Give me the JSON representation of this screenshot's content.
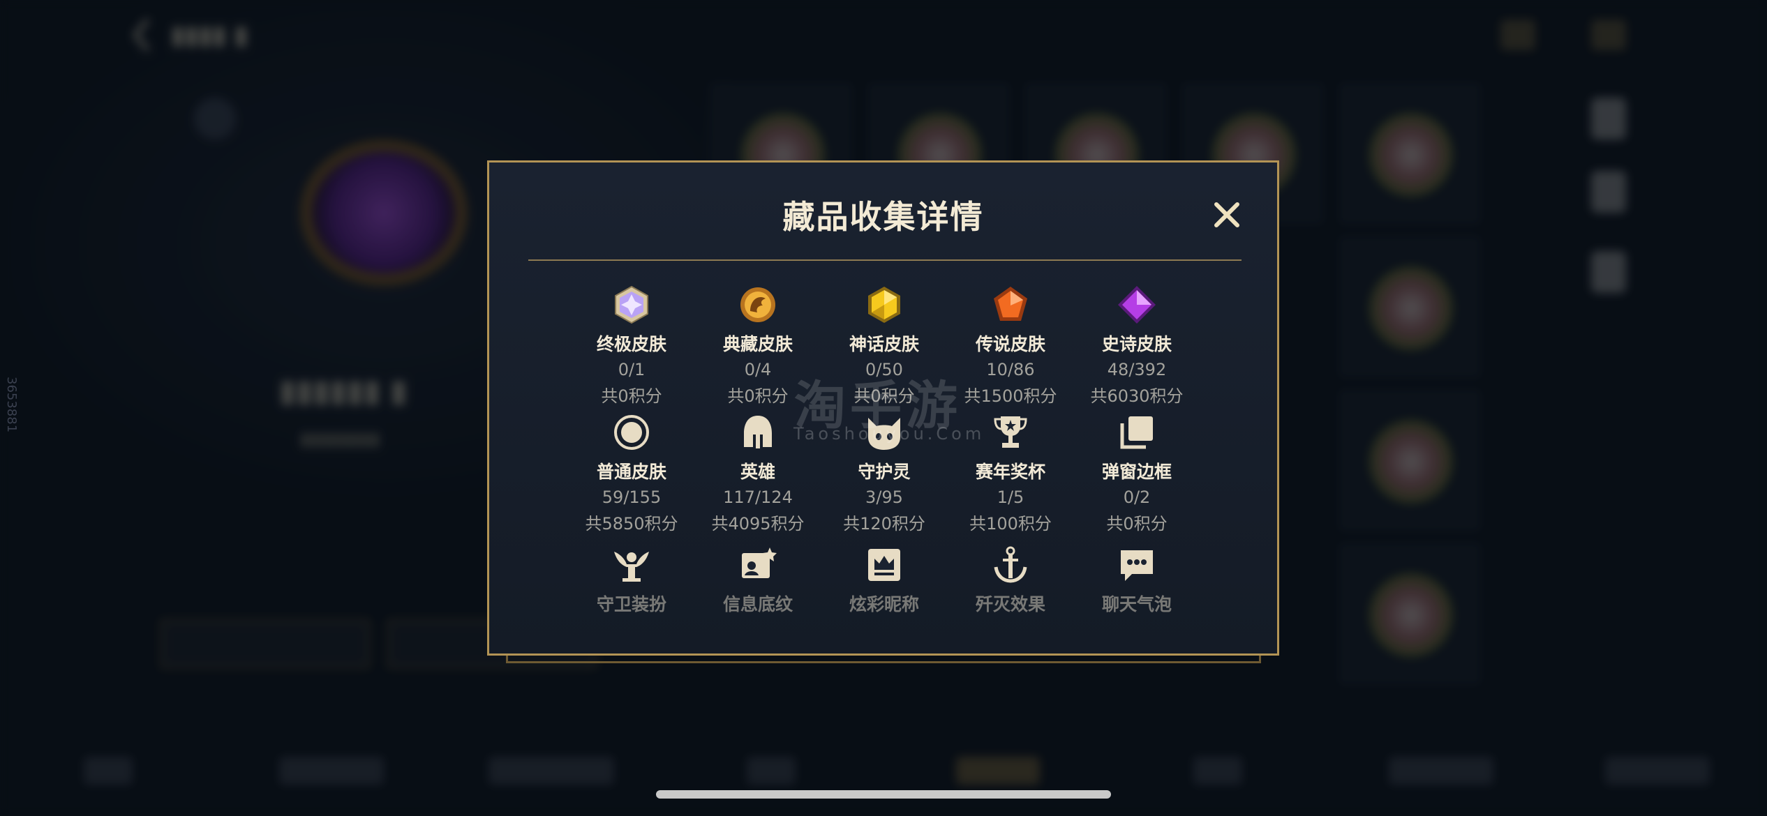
{
  "colors": {
    "gold_border": "#b39455",
    "modal_bg": "#161d28",
    "title_text": "#f3ead5",
    "muted_text": "#a3a29c"
  },
  "dialog": {
    "title": "藏品收集详情",
    "close_icon": "close-icon",
    "items": [
      {
        "name": "终极皮肤",
        "count": "0/1",
        "points": "共0积分",
        "icon": "ultimate-skin-icon",
        "color": "#c9a8ff"
      },
      {
        "name": "典藏皮肤",
        "count": "0/4",
        "points": "共0积分",
        "icon": "collector-skin-icon",
        "color": "#e3a43a"
      },
      {
        "name": "神话皮肤",
        "count": "0/50",
        "points": "共0积分",
        "icon": "mythic-skin-icon",
        "color": "#f2c21b"
      },
      {
        "name": "传说皮肤",
        "count": "10/86",
        "points": "共1500积分",
        "icon": "legendary-skin-icon",
        "color": "#f06a1f"
      },
      {
        "name": "史诗皮肤",
        "count": "48/392",
        "points": "共6030积分",
        "icon": "epic-skin-icon",
        "color": "#b23be0"
      },
      {
        "name": "普通皮肤",
        "count": "59/155",
        "points": "共5850积分",
        "icon": "normal-skin-icon",
        "color": "#e7dcc4"
      },
      {
        "name": "英雄",
        "count": "117/124",
        "points": "共4095积分",
        "icon": "hero-helmet-icon",
        "color": "#e7dcc4"
      },
      {
        "name": "守护灵",
        "count": "3/95",
        "points": "共120积分",
        "icon": "guardian-spirit-icon",
        "color": "#e7dcc4"
      },
      {
        "name": "赛年奖杯",
        "count": "1/5",
        "points": "共100积分",
        "icon": "trophy-icon",
        "color": "#e7dcc4"
      },
      {
        "name": "弹窗边框",
        "count": "0/2",
        "points": "共0积分",
        "icon": "popup-frame-icon",
        "color": "#e7dcc4"
      },
      {
        "name": "守卫装扮",
        "icon": "guard-outfit-icon",
        "color": "#e7dcc4"
      },
      {
        "name": "信息底纹",
        "icon": "info-pattern-icon",
        "color": "#e7dcc4"
      },
      {
        "name": "炫彩昵称",
        "icon": "colorful-nickname-icon",
        "color": "#e7dcc4"
      },
      {
        "name": "歼灭效果",
        "icon": "annihilation-effect-icon",
        "color": "#e7dcc4"
      },
      {
        "name": "聊天气泡",
        "icon": "chat-bubble-icon",
        "color": "#e7dcc4"
      }
    ]
  },
  "watermark": {
    "main": "淘手游",
    "sub": "Taoshouyou.Com"
  },
  "side_digits": "3653881"
}
